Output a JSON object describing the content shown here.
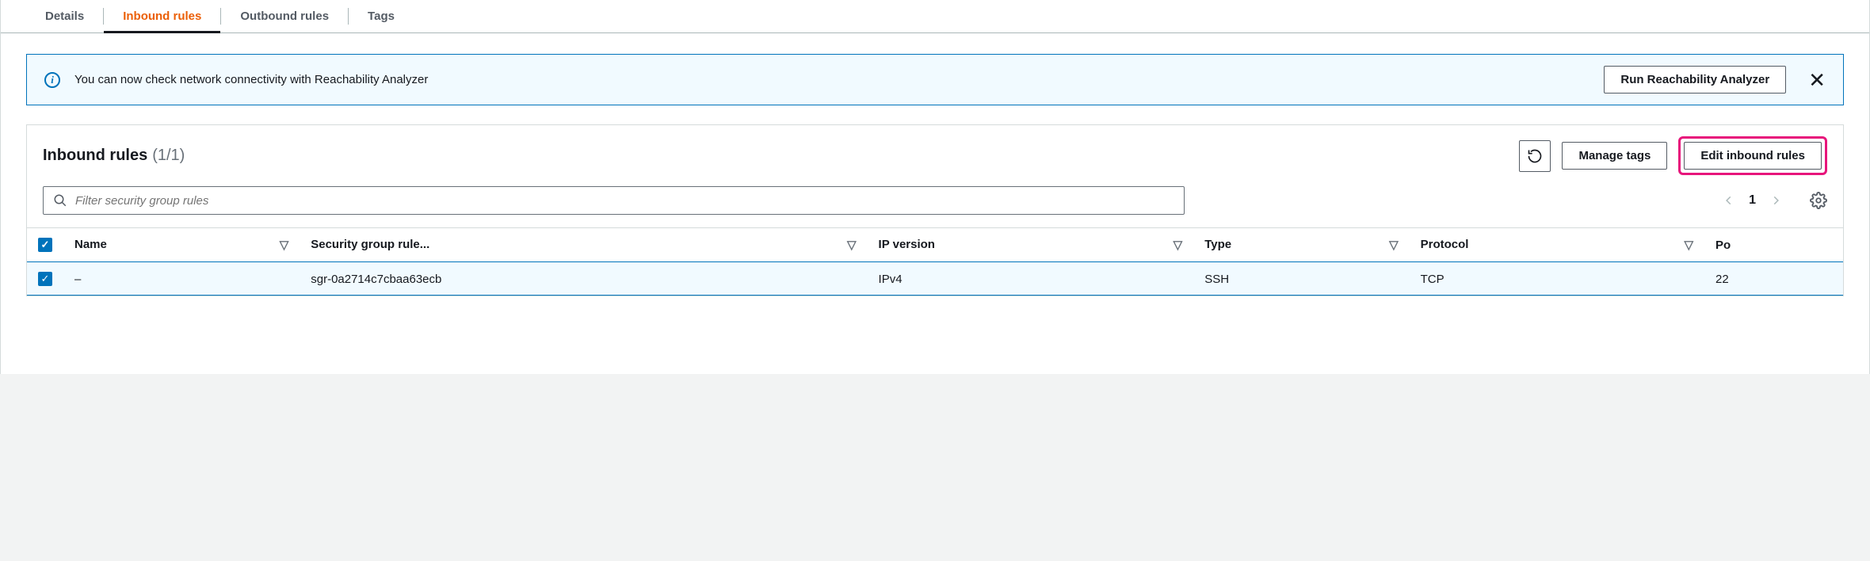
{
  "tabs": {
    "details": "Details",
    "inbound": "Inbound rules",
    "outbound": "Outbound rules",
    "tags": "Tags"
  },
  "banner": {
    "text": "You can now check network connectivity with Reachability Analyzer",
    "action": "Run Reachability Analyzer"
  },
  "panel": {
    "title": "Inbound rules",
    "count": "(1/1)",
    "manage_tags": "Manage tags",
    "edit_rules": "Edit inbound rules"
  },
  "search": {
    "placeholder": "Filter security group rules"
  },
  "pager": {
    "page": "1"
  },
  "columns": {
    "name": "Name",
    "sgr": "Security group rule...",
    "ipver": "IP version",
    "type": "Type",
    "protocol": "Protocol",
    "port": "Po"
  },
  "rows": [
    {
      "name": "–",
      "sgr": "sgr-0a2714c7cbaa63ecb",
      "ipver": "IPv4",
      "type": "SSH",
      "protocol": "TCP",
      "port": "22"
    }
  ]
}
